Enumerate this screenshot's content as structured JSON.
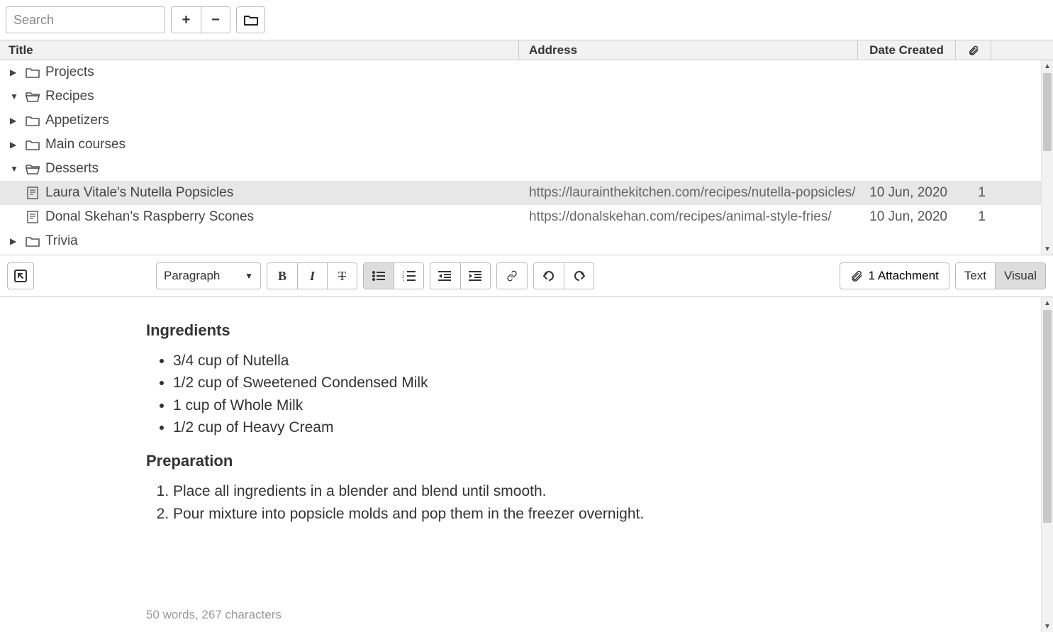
{
  "toolbar": {
    "search_placeholder": "Search"
  },
  "columns": {
    "title": "Title",
    "address": "Address",
    "date": "Date Created"
  },
  "tree": [
    {
      "level": 0,
      "expanded": false,
      "type": "folder",
      "label": "Projects",
      "address": "",
      "date": "",
      "attach": "",
      "selected": false
    },
    {
      "level": 0,
      "expanded": true,
      "type": "folder",
      "label": "Recipes",
      "address": "",
      "date": "",
      "attach": "",
      "selected": false
    },
    {
      "level": 1,
      "expanded": false,
      "type": "folder",
      "label": "Appetizers",
      "address": "",
      "date": "",
      "attach": "",
      "selected": false
    },
    {
      "level": 1,
      "expanded": false,
      "type": "folder",
      "label": "Main courses",
      "address": "",
      "date": "",
      "attach": "",
      "selected": false
    },
    {
      "level": 1,
      "expanded": true,
      "type": "folder",
      "label": "Desserts",
      "address": "",
      "date": "",
      "attach": "",
      "selected": false
    },
    {
      "level": 2,
      "expanded": null,
      "type": "item",
      "label": "Laura Vitale's Nutella Popsicles",
      "address": "https://laurainthekitchen.com/recipes/nutella-popsicles/",
      "date": "10 Jun, 2020",
      "attach": "1",
      "selected": true
    },
    {
      "level": 2,
      "expanded": null,
      "type": "item",
      "label": "Donal Skehan's Raspberry Scones",
      "address": "https://donalskehan.com/recipes/animal-style-fries/",
      "date": "10 Jun, 2020",
      "attach": "1",
      "selected": false
    },
    {
      "level": 0,
      "expanded": false,
      "type": "folder",
      "label": "Trivia",
      "address": "",
      "date": "",
      "attach": "",
      "selected": false
    }
  ],
  "editor_toolbar": {
    "format": "Paragraph",
    "attachment": "1 Attachment",
    "mode_text": "Text",
    "mode_visual": "Visual"
  },
  "content": {
    "heading1": "Ingredients",
    "ingredients": [
      "3/4 cup of Nutella",
      "1/2 cup of Sweetened Condensed Milk",
      "1 cup of Whole Milk",
      "1/2 cup of Heavy Cream"
    ],
    "heading2": "Preparation",
    "steps": [
      "Place all ingredients in a blender and blend until smooth.",
      "Pour mixture into popsicle molds and pop them in the freezer overnight."
    ]
  },
  "status": {
    "word_count": "50 words, 267 characters"
  }
}
